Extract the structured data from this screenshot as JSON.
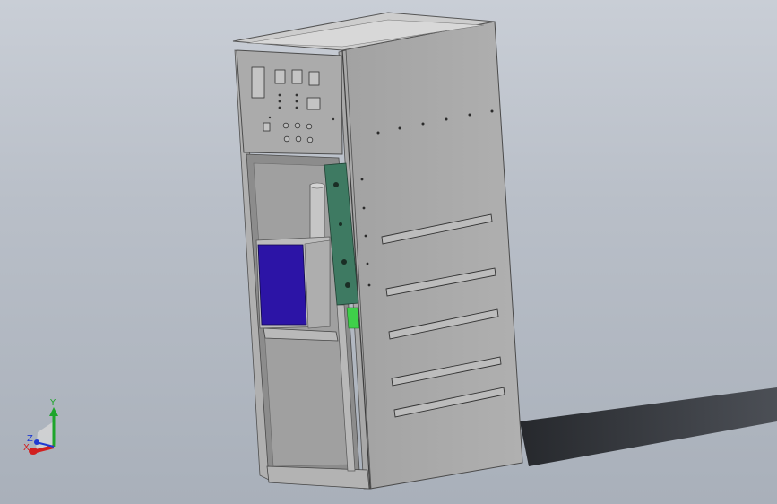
{
  "viewport": {
    "background_top": "#c9ced6",
    "background_bottom": "#a9b0ba",
    "shadow_color": "#2a2c30"
  },
  "model": {
    "cabinet_color": "#9a9a9a",
    "side_panel_color": "#a5a5a5",
    "top_color": "#c8c8c8",
    "front_frame_color": "#b2b2b2",
    "inner_bracket_color": "#3f7b63",
    "inner_box_color": "#2a14a8",
    "accent_green": "#3cd04a"
  },
  "triad": {
    "x_label": "X",
    "y_label": "Y",
    "z_label": "Z",
    "x_color": "#d21f1f",
    "y_color": "#1ea52b",
    "z_color": "#1f3ad2"
  }
}
